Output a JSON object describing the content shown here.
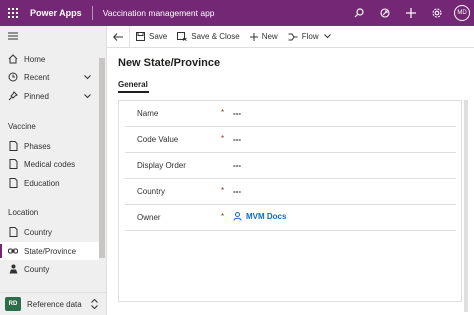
{
  "topbar": {
    "brand": "Power Apps",
    "app_name": "Vaccination management app",
    "avatar_initials": "MD",
    "icons": [
      "waffle-icon",
      "search-icon",
      "assistant-icon",
      "plus-icon",
      "settings-icon"
    ],
    "background": "#742774"
  },
  "sidebar": {
    "items": [
      {
        "label": "Home",
        "icon": "home-icon"
      },
      {
        "label": "Recent",
        "icon": "clock-icon"
      },
      {
        "label": "Pinned",
        "icon": "pin-icon"
      }
    ],
    "groups": [
      {
        "title": "Vaccine",
        "items": [
          {
            "label": "Phases",
            "icon": "document-icon"
          },
          {
            "label": "Medical codes",
            "icon": "document-icon"
          },
          {
            "label": "Education",
            "icon": "document-icon"
          }
        ]
      },
      {
        "title": "Location",
        "items": [
          {
            "label": "Country",
            "icon": "document-icon"
          },
          {
            "label": "State/Province",
            "icon": "link-icon",
            "selected": true
          },
          {
            "label": "County",
            "icon": "person-icon"
          }
        ]
      }
    ],
    "area": {
      "badge": "RD",
      "label": "Reference data"
    }
  },
  "commandbar": {
    "save": "Save",
    "save_close": "Save & Close",
    "new": "New",
    "flow": "Flow"
  },
  "form": {
    "title": "New State/Province",
    "tab": "General",
    "fields": [
      {
        "label": "Name",
        "required": "*",
        "value": "---"
      },
      {
        "label": "Code Value",
        "required": "*",
        "value": "---"
      },
      {
        "label": "Display Order",
        "required": "",
        "value": "---"
      },
      {
        "label": "Country",
        "required": "*",
        "value": "---"
      },
      {
        "label": "Owner",
        "required": "*",
        "value": "MVM Docs"
      }
    ]
  },
  "colors": {
    "accent": "#742774",
    "link": "#0f6cbd",
    "required": "#a4262c",
    "area_badge": "#2c6e49"
  }
}
